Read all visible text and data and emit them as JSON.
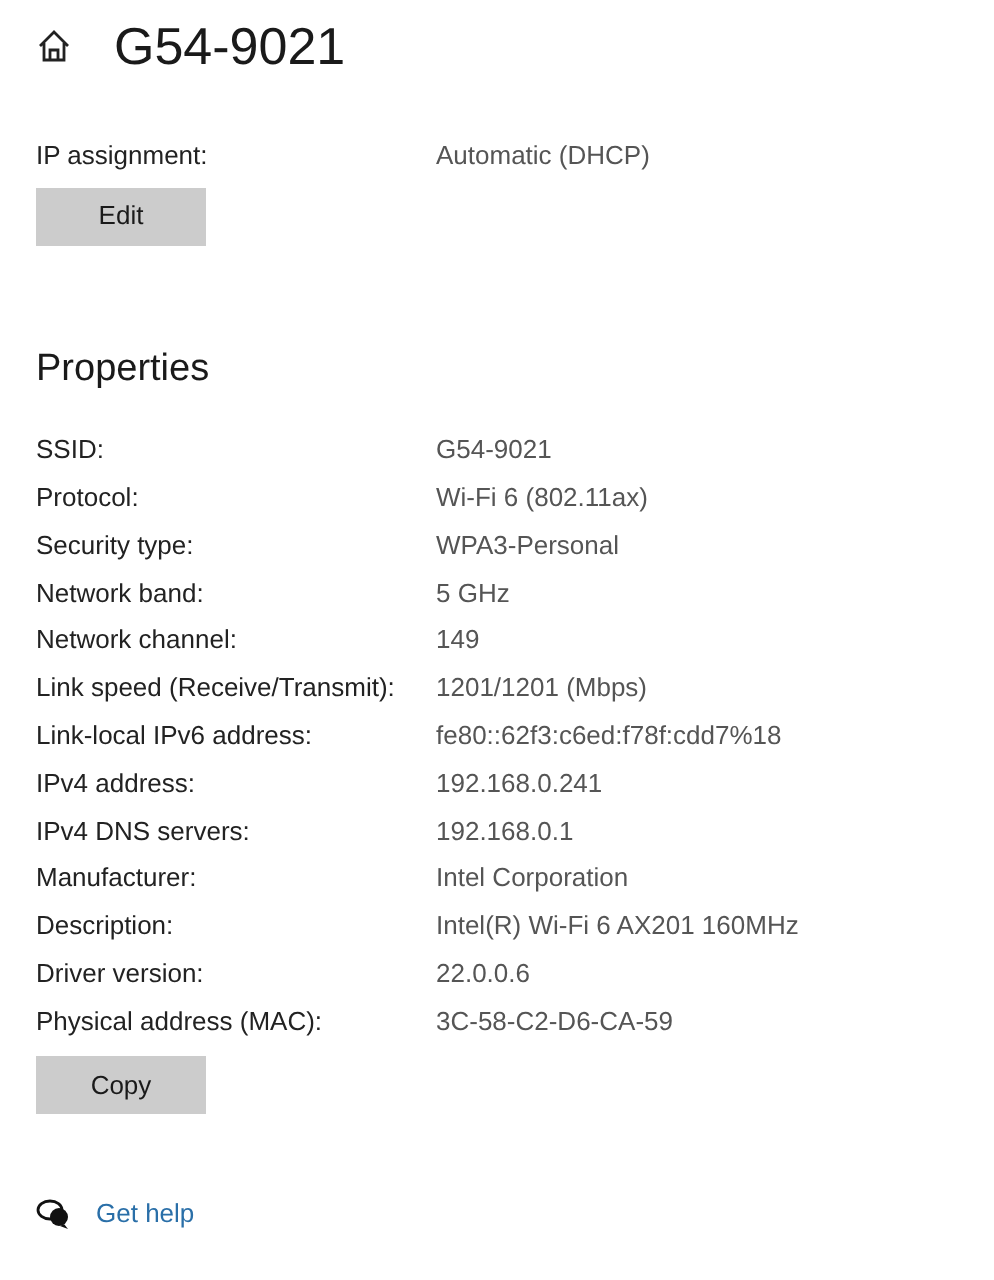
{
  "header": {
    "title": "G54-9021"
  },
  "ip_settings": {
    "label": "IP assignment:",
    "value": "Automatic (DHCP)",
    "button": "Edit"
  },
  "properties": {
    "heading": "Properties",
    "rows": [
      {
        "label": "SSID:",
        "value": "G54-9021"
      },
      {
        "label": "Protocol:",
        "value": "Wi-Fi 6 (802.11ax)"
      },
      {
        "label": "Security type:",
        "value": "WPA3-Personal"
      },
      {
        "label": "Network band:",
        "value": "5 GHz"
      },
      {
        "label": "Network channel:",
        "value": "149"
      },
      {
        "label": "Link speed (Receive/Transmit):",
        "value": "1201/1201 (Mbps)"
      },
      {
        "label": "Link-local IPv6 address:",
        "value": "fe80::62f3:c6ed:f78f:cdd7%18"
      },
      {
        "label": "IPv4 address:",
        "value": "192.168.0.241"
      },
      {
        "label": "IPv4 DNS servers:",
        "value": "192.168.0.1"
      },
      {
        "label": "Manufacturer:",
        "value": "Intel Corporation"
      },
      {
        "label": "Description:",
        "value": "Intel(R) Wi-Fi 6 AX201 160MHz"
      },
      {
        "label": "Driver version:",
        "value": "22.0.0.6"
      },
      {
        "label": "Physical address (MAC):",
        "value": "3C-58-C2-D6-CA-59"
      }
    ],
    "button": "Copy"
  },
  "help_link": "Get help"
}
